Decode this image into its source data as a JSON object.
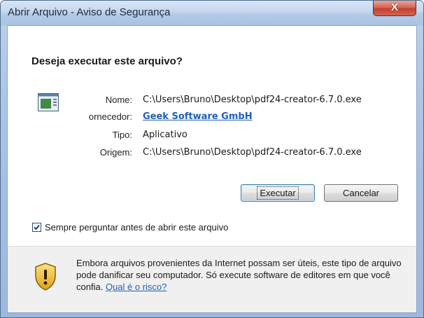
{
  "window": {
    "title": "Abrir Arquivo - Aviso de Segurança",
    "close_symbol": "X"
  },
  "dialog": {
    "heading": "Deseja executar este arquivo?",
    "fields": [
      {
        "label": "Nome:",
        "value": "C:\\Users\\Bruno\\Desktop\\pdf24-creator-6.7.0.exe"
      },
      {
        "label": "ornecedor:",
        "value": "Geek Software GmbH"
      },
      {
        "label": "Tipo:",
        "value": "Aplicativo"
      },
      {
        "label": "Origem:",
        "value": "C:\\Users\\Bruno\\Desktop\\pdf24-creator-6.7.0.exe"
      }
    ],
    "buttons": {
      "run": "Executar",
      "cancel": "Cancelar"
    },
    "checkbox": {
      "label": "Sempre perguntar antes de abrir este arquivo",
      "checked": true
    },
    "warning": {
      "text": "Embora arquivos provenientes da Internet possam ser úteis, este tipo de arquivo pode danificar seu computador. Só execute software de editores em que você confia.",
      "link": "Qual é o risco?"
    }
  },
  "colors": {
    "link": "#1f5fb8",
    "close": "#c4402f"
  }
}
